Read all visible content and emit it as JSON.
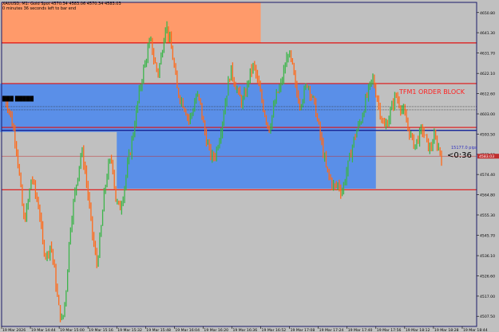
{
  "header": {
    "line1": "XAUUSD, M1:  Gold Spot  4570.34 4583.06 4570.34 4583.03",
    "line2": "0 minutes 36 seconds left to bar end"
  },
  "left_overlay_text": "███ █████",
  "order_block_label": "TFM1 ORDER BLOCK",
  "pips_label": "15177.0 pips",
  "countdown": "<0:36",
  "colors": {
    "background": "#c0c0c0",
    "candle_up": "#3cb54a",
    "candle_down": "#ff6a1a",
    "blue_zone": "#5a8fe8",
    "orange_zone": "#ff9a6a",
    "green_zone": "#1ee87a",
    "red_line": "#e01010",
    "blue_line": "#1a2a9a",
    "axis_line": "#1a1a6a"
  },
  "price_axis": {
    "labels": [
      "4650.80",
      "4641.30",
      "4631.70",
      "4622.10",
      "4612.60",
      "4603.00",
      "4593.50",
      "4583.90",
      "4574.40",
      "4564.80",
      "4555.30",
      "4545.70",
      "4536.10",
      "4526.60",
      "4517.00",
      "4507.50"
    ]
  },
  "time_axis": {
    "labels": [
      "19 Mar 2026",
      "19 Mar 14:44",
      "19 Mar 15:00",
      "19 Mar 15:16",
      "19 Mar 15:32",
      "19 Mar 15:48",
      "19 Mar 16:04",
      "19 Mar 16:20",
      "19 Mar 16:36",
      "19 Mar 16:52",
      "19 Mar 17:08",
      "19 Mar 17:24",
      "19 Mar 17:40",
      "19 Mar 17:56",
      "19 Mar 18:12",
      "19 Mar 18:28",
      "19 Mar 18:44"
    ]
  },
  "chart_data": {
    "type": "candlestick",
    "symbol": "XAUUSD",
    "timeframe": "M1",
    "ylim": [
      4502.7,
      4655.6
    ],
    "horizontal_lines": [
      4636.5,
      4617.3,
      4596.6,
      4595.2,
      4567.2
    ],
    "zones": [
      {
        "kind": "orange",
        "from_time": "19 Mar 2026",
        "to_time": "19 Mar 16:52",
        "price_top": 4655.6,
        "price_bottom": 4636.5
      },
      {
        "kind": "blue",
        "from_time": "19 Mar 15:56",
        "to_time": "19 Mar 17:56",
        "price_top": 4617.3,
        "price_bottom": 4594.5
      },
      {
        "kind": "blue",
        "from_time": "19 Mar 15:32",
        "to_time": "19 Mar 17:56",
        "price_top": 4594.5,
        "price_bottom": 4567.7
      },
      {
        "kind": "green",
        "from_time": "19 Mar 17:32",
        "to_time": "19 Mar 17:54",
        "price_top": 4603.0,
        "price_bottom": 4599.3
      }
    ],
    "close_path": [
      4610,
      4606,
      4598,
      4588,
      4570,
      4552,
      4560,
      4574,
      4565,
      4558,
      4540,
      4536,
      4542,
      4528,
      4512,
      4504,
      4520,
      4548,
      4562,
      4574,
      4586,
      4576,
      4560,
      4544,
      4532,
      4546,
      4566,
      4578,
      4582,
      4562,
      4558,
      4566,
      4578,
      4588,
      4600,
      4612,
      4622,
      4630,
      4638,
      4628,
      4622,
      4632,
      4646,
      4638,
      4628,
      4614,
      4610,
      4606,
      4600,
      4604,
      4612,
      4608,
      4596,
      4588,
      4582,
      4584,
      4592,
      4602,
      4614,
      4624,
      4618,
      4612,
      4608,
      4614,
      4622,
      4626,
      4618,
      4610,
      4602,
      4596,
      4604,
      4612,
      4616,
      4624,
      4632,
      4626,
      4614,
      4608,
      4612,
      4618,
      4612,
      4606,
      4596,
      4586,
      4576,
      4572,
      4568,
      4570,
      4566,
      4574,
      4582,
      4590,
      4596,
      4600,
      4608,
      4614,
      4620,
      4612,
      4604,
      4596,
      4600,
      4606,
      4612,
      4608,
      4604,
      4598,
      4592,
      4588,
      4592,
      4596,
      4590,
      4586,
      4592,
      4588,
      4583
    ]
  }
}
